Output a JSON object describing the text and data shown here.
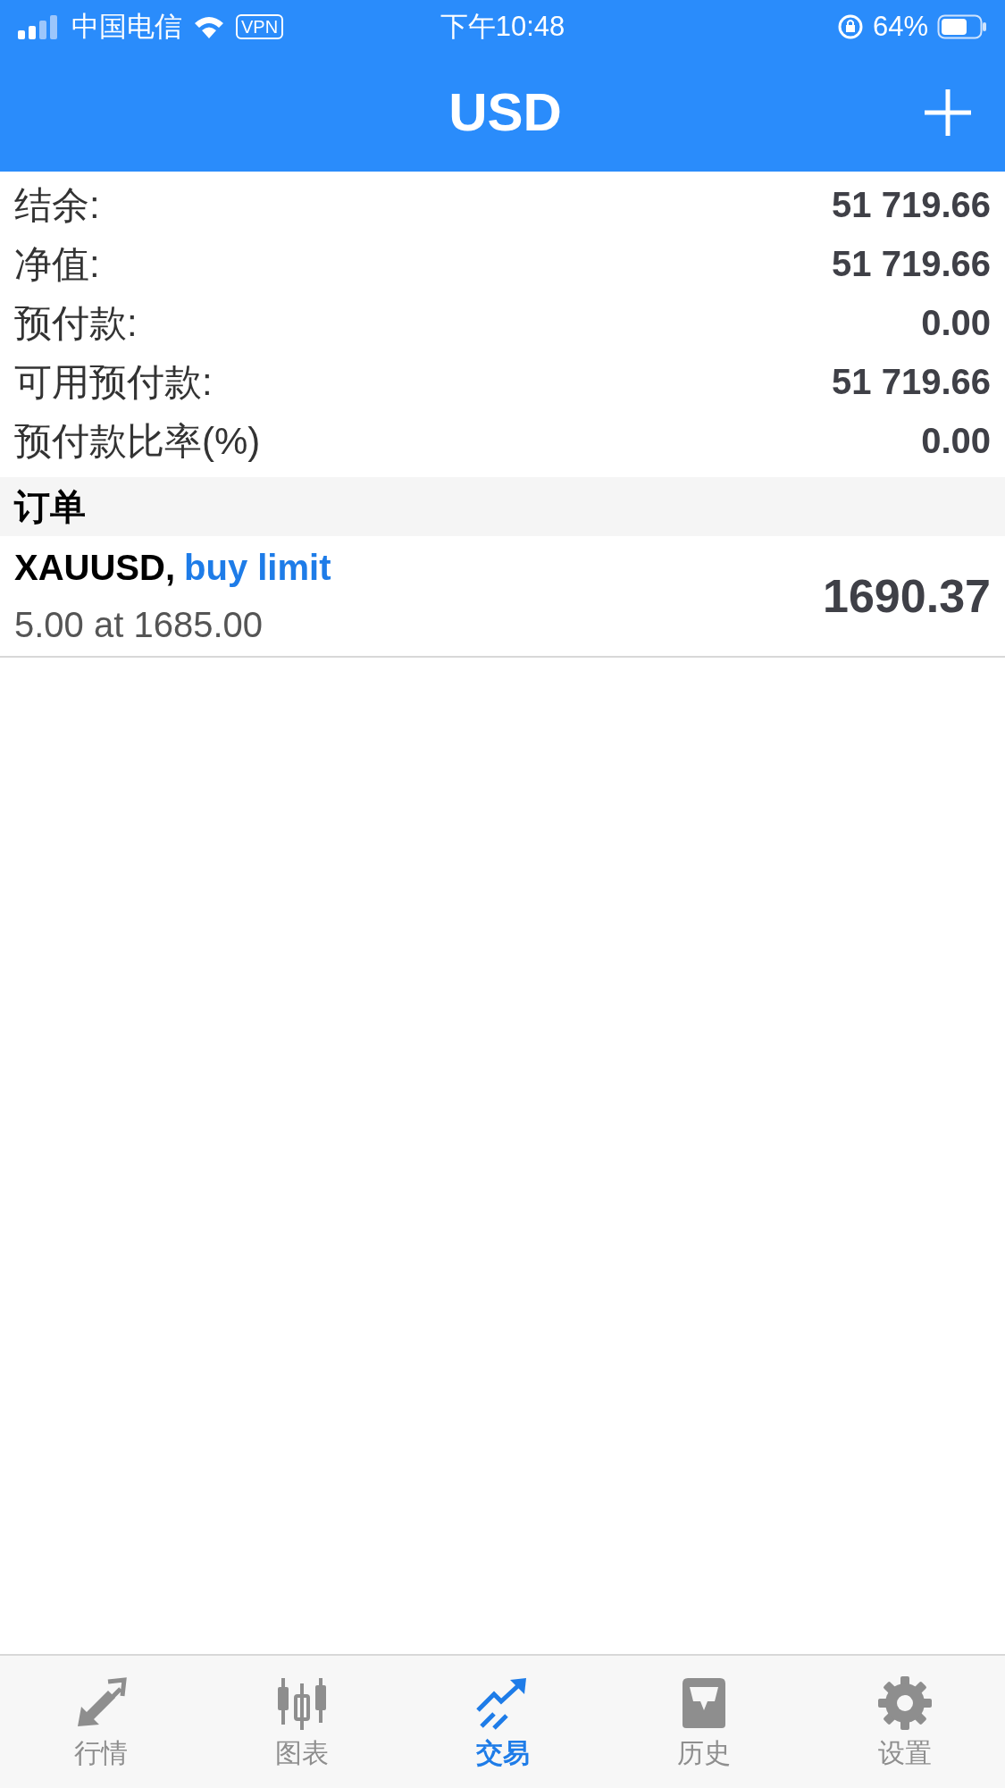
{
  "status_bar": {
    "carrier": "中国电信",
    "vpn": "VPN",
    "time": "下午10:48",
    "battery": "64%"
  },
  "header": {
    "title": "USD"
  },
  "summary": [
    {
      "label": "结余:",
      "value": "51 719.66"
    },
    {
      "label": "净值:",
      "value": "51 719.66"
    },
    {
      "label": "预付款:",
      "value": "0.00"
    },
    {
      "label": "可用预付款:",
      "value": "51 719.66"
    },
    {
      "label": "预付款比率(%)",
      "value": "0.00"
    }
  ],
  "orders_section": {
    "title": "订单"
  },
  "orders": [
    {
      "symbol": "XAUUSD,",
      "type": "buy limit",
      "volume": "5.00 at 1685.00",
      "price": "1690.37"
    }
  ],
  "tab_bar": [
    {
      "label": "行情",
      "kind": "quotes",
      "selected": false
    },
    {
      "label": "图表",
      "kind": "chart",
      "selected": false
    },
    {
      "label": "交易",
      "kind": "trade",
      "selected": true
    },
    {
      "label": "历史",
      "kind": "history",
      "selected": false
    },
    {
      "label": "设置",
      "kind": "settings",
      "selected": false
    }
  ]
}
